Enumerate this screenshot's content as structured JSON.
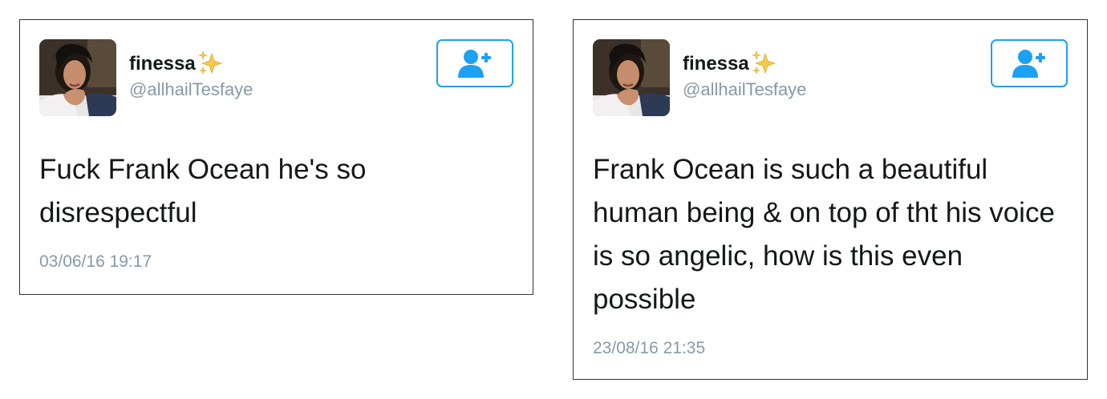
{
  "colors": {
    "accent": "#1da1f2",
    "secondary_text": "#8899a6",
    "primary_text": "#14171a",
    "border": "#333333"
  },
  "tweets": [
    {
      "display_name": "finessa",
      "name_emoji": "sparkles-icon",
      "handle": "@allhailTesfaye",
      "text": "Fuck Frank Ocean he's so disrespectful",
      "timestamp": "03/06/16 19:17",
      "follow_icon": "follow-user-plus-icon"
    },
    {
      "display_name": "finessa",
      "name_emoji": "sparkles-icon",
      "handle": "@allhailTesfaye",
      "text": "Frank Ocean is such a beautiful human being & on top of tht his voice is so angelic, how is this even possible",
      "timestamp": "23/08/16 21:35",
      "follow_icon": "follow-user-plus-icon"
    }
  ]
}
